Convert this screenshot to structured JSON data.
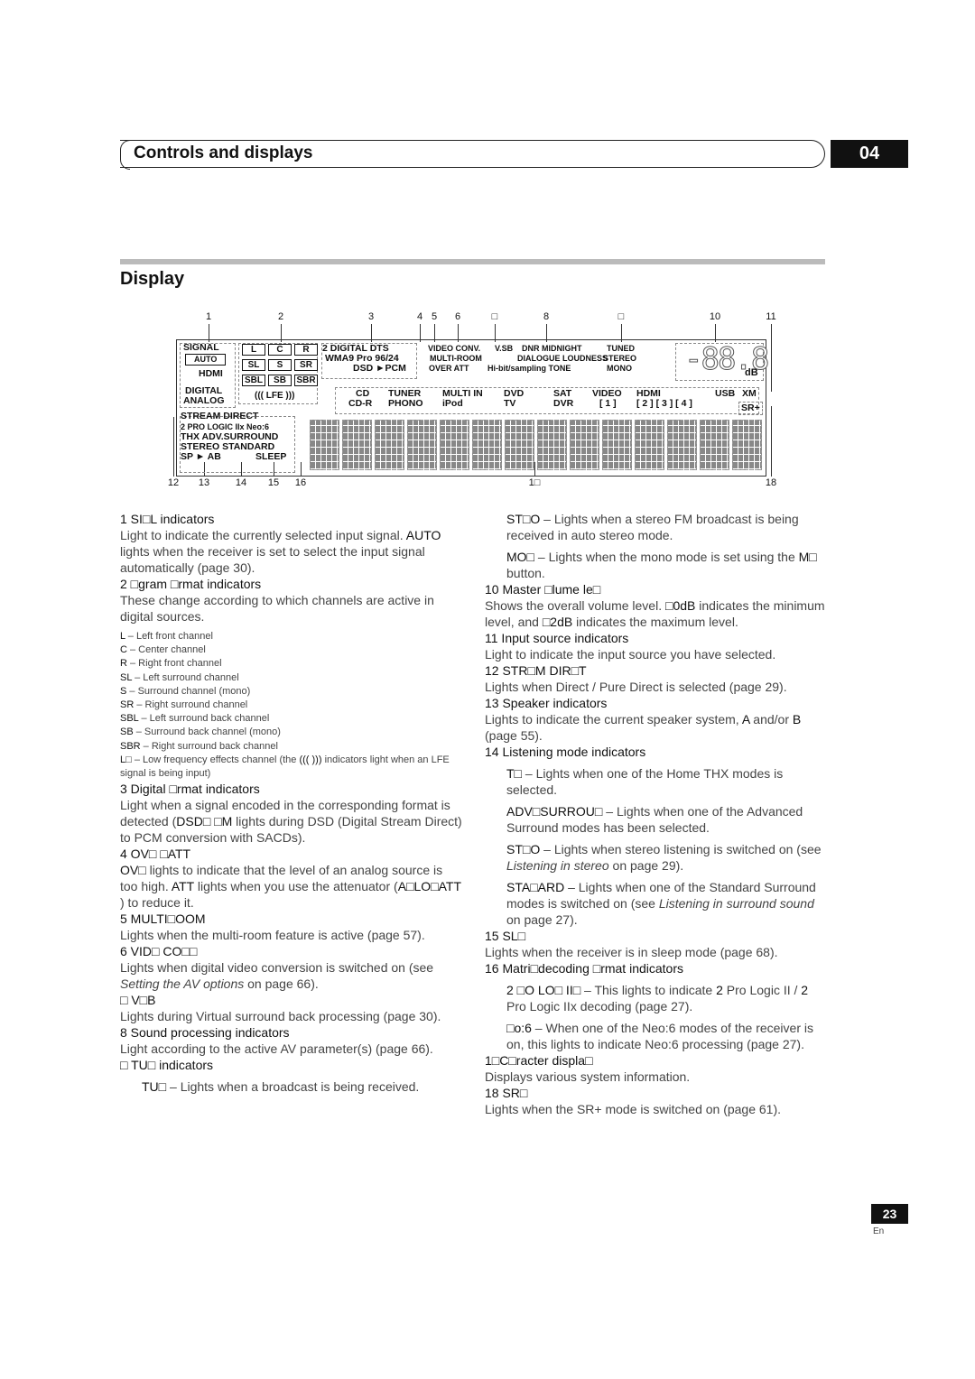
{
  "header": {
    "title": "Controls and displays",
    "chapter": "04"
  },
  "section_title": "Display",
  "diagram": {
    "callouts_top": [
      "1",
      "2",
      "3",
      "4",
      "5",
      "6",
      "□",
      "8",
      "□",
      "10",
      "11"
    ],
    "callouts_bottom": [
      "12",
      "13",
      "14",
      "15",
      "16",
      "1□",
      "18"
    ],
    "signal": [
      "SIGNAL",
      "AUTO",
      "HDMI",
      "DIGITAL",
      "ANALOG"
    ],
    "channels": [
      [
        "L",
        "C",
        "R"
      ],
      [
        "SL",
        "S",
        "SR"
      ],
      [
        "SBL",
        "SB",
        "SBR"
      ]
    ],
    "lfe": "((( LFE )))",
    "digital": [
      "2 DIGITAL   DTS",
      "WMA9 Pro  96/24",
      "DSD ►PCM"
    ],
    "video": [
      "VIDEO CONV.",
      "V.SB",
      "MULTI-ROOM",
      "OVER   ATT"
    ],
    "sound": [
      "DNR  MIDNIGHT",
      "DIALOGUE LOUDNESS",
      "Hi-bit/sampling  TONE"
    ],
    "tuner": [
      "TUNED",
      "STEREO",
      "MONO"
    ],
    "volume": {
      "digits": "-88.8",
      "unit": "dB"
    },
    "inputs": [
      [
        "CD",
        "CD-R"
      ],
      [
        "TUNER",
        "PHONO"
      ],
      [
        "MULTI IN",
        "iPod"
      ],
      [
        "DVD",
        "TV"
      ],
      [
        "SAT",
        "DVR"
      ],
      [
        "VIDEO",
        "[ 1 ]"
      ],
      [
        "HDMI",
        "[ 2 ] [ 3 ] [ 4 ]"
      ],
      [
        "USB",
        ""
      ],
      [
        "XM",
        ""
      ]
    ],
    "sr_plus": "SR+",
    "modes": [
      "STREAM DIRECT",
      "2  PRO LOGIC IIx Neo:6",
      "THX   ADV.SURROUND",
      "STEREO   STANDARD",
      "SP ► AB",
      "SLEEP"
    ]
  },
  "left_column": [
    {
      "h": "1   SI□L      indicators",
      "p": [
        [
          [
            "Light to indicate the currently selected input signal. "
          ],
          [
            "AUTO",
            "b"
          ],
          [
            " lights when the receiver is set to select the input signal automatically (page 30)."
          ]
        ]
      ]
    },
    {
      "h": "2   □gram □rmat indicators",
      "p": [
        [
          [
            "These change according to which channels are active in digital sources."
          ]
        ]
      ],
      "small": [
        [
          [
            "L",
            "b"
          ],
          [
            " – Left front channel"
          ]
        ],
        [
          [
            "C",
            "b"
          ],
          [
            " – Center channel"
          ]
        ],
        [
          [
            "R",
            "b"
          ],
          [
            " – Right front channel"
          ]
        ],
        [
          [
            "SL",
            "b"
          ],
          [
            " – Left surround channel"
          ]
        ],
        [
          [
            "S",
            "b"
          ],
          [
            " – Surround channel (mono)"
          ]
        ],
        [
          [
            "SR",
            "b"
          ],
          [
            " – Right surround channel"
          ]
        ],
        [
          [
            "SBL",
            "b"
          ],
          [
            " – Left surround back channel"
          ]
        ],
        [
          [
            "SB",
            "b"
          ],
          [
            " – Surround back channel (mono)"
          ]
        ],
        [
          [
            "SBR",
            "b"
          ],
          [
            " – Right surround back channel"
          ]
        ],
        [
          [
            "L□",
            "b"
          ],
          [
            "  – Low frequency effects channel (the "
          ],
          [
            "(((   )))",
            "b"
          ],
          [
            " indicators light when an LFE signal is being input)"
          ]
        ]
      ]
    },
    {
      "h": "3   Digital □rmat indicators",
      "p": [
        [
          [
            "Light when a signal encoded in the corresponding format is detected ("
          ],
          [
            "DSD□ □M",
            "b"
          ],
          [
            "   lights during DSD (Digital Stream Direct) to PCM conversion with SACDs)."
          ]
        ]
      ]
    },
    {
      "h": "4   OV□  □ATT",
      "p": [
        [
          [
            "OV□",
            "b"
          ],
          [
            "   lights to indicate that the level of an analog source is too high. "
          ],
          [
            "ATT",
            "b"
          ],
          [
            " lights when you use the attenuator ("
          ],
          [
            "A□LO□ATT",
            "b"
          ],
          [
            "      ) to reduce it."
          ]
        ]
      ]
    },
    {
      "h": "5   MULTI□OOM",
      "p": [
        [
          [
            "Lights when the multi-room feature is active (page 57)."
          ]
        ]
      ]
    },
    {
      "h": "6   VID□ CO□□",
      "p": [
        [
          [
            "Lights when digital video conversion is switched on (see "
          ],
          [
            "Setting the AV options",
            "i"
          ],
          [
            " on page 66)."
          ]
        ]
      ]
    },
    {
      "h": "□   V□B",
      "p": [
        [
          [
            "Lights during Virtual surround back processing (page 30)."
          ]
        ]
      ]
    },
    {
      "h": "8   Sound processing indicators",
      "p": [
        [
          [
            "Light according to the active AV parameter(s) (page 66)."
          ]
        ]
      ]
    },
    {
      "h": "□   TU□      indicators",
      "ind": [
        [
          [
            "TU□",
            "b"
          ],
          [
            "       – Lights when a broadcast is being received."
          ]
        ]
      ]
    }
  ],
  "right_column": [
    {
      "ind": [
        [
          [
            "ST□O",
            "b"
          ],
          [
            "     – Lights when a stereo FM broadcast is being received in auto stereo mode."
          ]
        ],
        [
          [
            "MO□",
            "b"
          ],
          [
            "     – Lights when the mono mode is set using the "
          ],
          [
            "M□",
            "b"
          ],
          [
            "    button."
          ]
        ]
      ]
    },
    {
      "h": "10  Master □lume le□",
      "p": [
        [
          [
            "Shows the overall volume level. "
          ],
          [
            "□0dB",
            "b"
          ],
          [
            "    indicates the minimum level, and "
          ],
          [
            "□2dB",
            "b"
          ],
          [
            "    indicates the maximum level."
          ]
        ]
      ]
    },
    {
      "h": "11  Input source indicators",
      "p": [
        [
          [
            "Light to indicate the input source you have selected."
          ]
        ]
      ]
    },
    {
      "h": "12  STR□M DIR□T",
      "p": [
        [
          [
            "Lights when Direct / Pure Direct is selected (page 29)."
          ]
        ]
      ]
    },
    {
      "h": "13  Speaker indicators",
      "p": [
        [
          [
            "Lights to indicate the current speaker system, "
          ],
          [
            "A",
            "b"
          ],
          [
            " and/or "
          ],
          [
            "B",
            "b"
          ],
          [
            " (page 55)."
          ]
        ]
      ]
    },
    {
      "h": "14  Listening mode indicators",
      "ind": [
        [
          [
            "T□",
            "b"
          ],
          [
            "    – Lights when one of the Home THX modes is selected."
          ]
        ],
        [
          [
            "ADV□SURROU□",
            "b"
          ],
          [
            "     – Lights when one of the Advanced Surround modes has been selected."
          ]
        ],
        [
          [
            "ST□O",
            "b"
          ],
          [
            "     – Lights when stereo listening is switched on (see "
          ],
          [
            "Listening in stereo",
            "i"
          ],
          [
            " on page 29)."
          ]
        ],
        [
          [
            "STA□ARD",
            "b"
          ],
          [
            "   – Lights when one of the Standard Surround modes is switched on (see "
          ],
          [
            "Listening in surround sound",
            "i"
          ],
          [
            " on page 27)."
          ]
        ]
      ]
    },
    {
      "h": "15  SL□",
      "p": [
        [
          [
            "Lights when the receiver is in sleep mode (page 68)."
          ]
        ]
      ]
    },
    {
      "h": "16  Matri□decoding □rmat indicators",
      "ind": [
        [
          [
            "2  □O LO□ II□",
            "b"
          ],
          [
            "     – This lights to indicate "
          ],
          [
            "2",
            "b"
          ],
          [
            "   Pro Logic II / "
          ],
          [
            "2",
            "b"
          ],
          [
            "   Pro Logic IIx decoding (page 27)."
          ]
        ],
        [
          [
            "□o:6",
            "b"
          ],
          [
            "    – When one of the Neo:6 modes of the receiver is on, this lights to indicate Neo:6 processing (page 27)."
          ]
        ]
      ]
    },
    {
      "h": "1□C□racter displa□",
      "p": [
        [
          [
            "Displays various system information."
          ]
        ]
      ]
    },
    {
      "h": "18  SR□",
      "p": [
        [
          [
            "Lights when the SR+ mode is switched on (page 61)."
          ]
        ]
      ]
    }
  ],
  "footer": {
    "page": "23",
    "lang": "En"
  }
}
